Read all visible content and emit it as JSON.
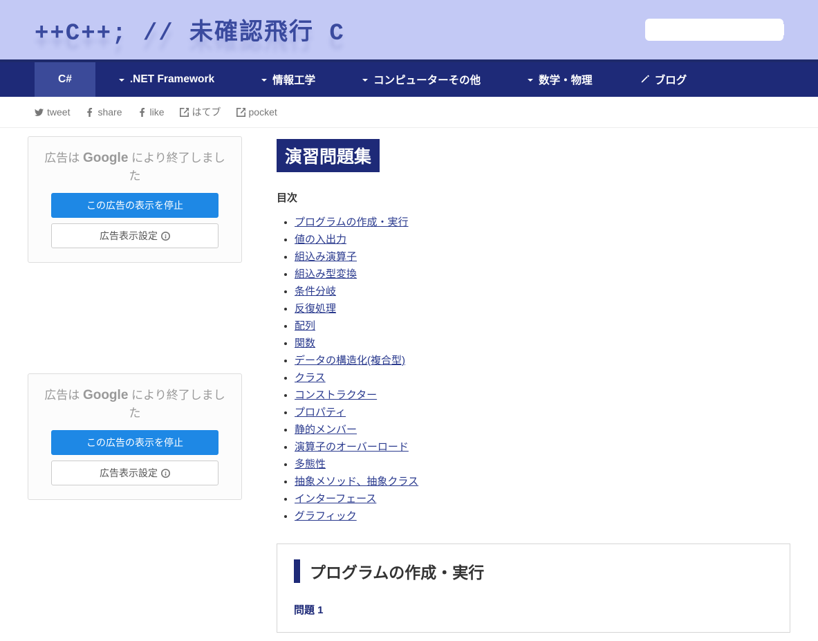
{
  "header": {
    "site_title": "++C++; // 未確認飛行 C"
  },
  "search": {
    "placeholder": ""
  },
  "nav": {
    "items": [
      {
        "label": "C#",
        "dropdown": false,
        "active": true
      },
      {
        "label": ".NET Framework",
        "dropdown": true
      },
      {
        "label": "情報工学",
        "dropdown": true
      },
      {
        "label": "コンピューターその他",
        "dropdown": true
      },
      {
        "label": "数学・物理",
        "dropdown": true
      },
      {
        "label": "ブログ",
        "dropdown": false,
        "icon": "pencil"
      }
    ]
  },
  "social": [
    {
      "label": "tweet",
      "icon": "twitter"
    },
    {
      "label": "share",
      "icon": "facebook"
    },
    {
      "label": "like",
      "icon": "facebook"
    },
    {
      "label": "はてブ",
      "icon": "share-out"
    },
    {
      "label": "pocket",
      "icon": "share-out"
    }
  ],
  "ads": {
    "text_prefix": "広告は ",
    "google": "Google",
    "text_suffix": " により終了しました",
    "stop_button": "この広告の表示を停止",
    "settings_button": "広告表示設定"
  },
  "page": {
    "title": "演習問題集",
    "toc_heading": "目次",
    "toc": [
      "プログラムの作成・実行",
      "値の入出力",
      "組込み演算子",
      "組込み型変換",
      "条件分岐",
      "反復処理",
      "配列",
      "関数",
      "データの構造化(複合型)",
      "クラス",
      "コンストラクター",
      "プロパティ",
      "静的メンバー",
      "演算子のオーバーロード",
      "多態性",
      "抽象メソッド、抽象クラス",
      "インターフェース",
      "グラフィック"
    ],
    "section_title": "プログラムの作成・実行",
    "problem_label": "問題 1"
  }
}
